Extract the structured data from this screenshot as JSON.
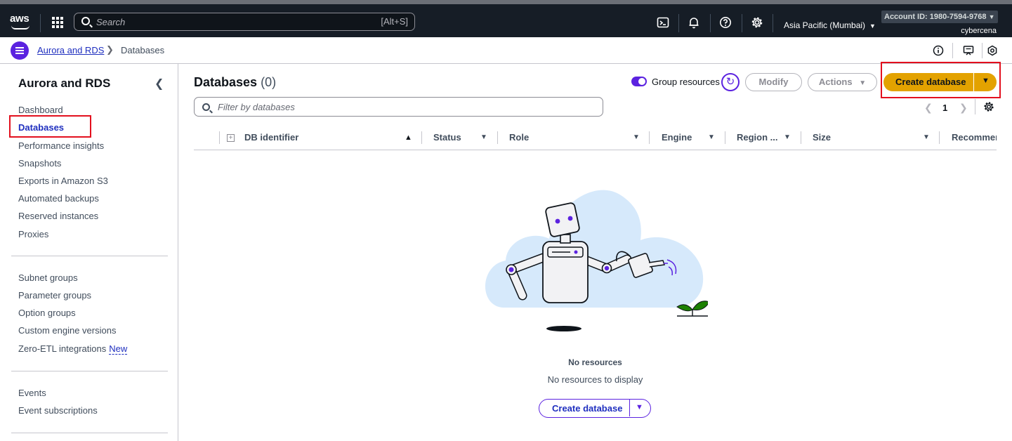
{
  "topbar": {
    "logo": "aws",
    "search_placeholder": "Search",
    "search_shortcut": "[Alt+S]",
    "icons": [
      "cloudshell-icon",
      "bell-icon",
      "help-icon",
      "gear-icon"
    ],
    "region": "Asia Pacific (Mumbai)",
    "account": "Account ID: 1980-7594-9768",
    "user": "cybercena"
  },
  "breadcrumb": {
    "parent": "Aurora and RDS",
    "current": "Databases"
  },
  "sidebar": {
    "title": "Aurora and RDS",
    "group1": [
      "Dashboard",
      "Databases",
      "Performance insights",
      "Snapshots",
      "Exports in Amazon S3",
      "Automated backups",
      "Reserved instances",
      "Proxies"
    ],
    "group2": [
      "Subnet groups",
      "Parameter groups",
      "Option groups",
      "Custom engine versions",
      "Zero-ETL integrations"
    ],
    "new_badge": "New",
    "group3": [
      "Events",
      "Event subscriptions"
    ],
    "active_item": "Databases"
  },
  "main": {
    "title": "Databases",
    "count": "(0)",
    "group_resources_label": "Group resources",
    "modify_label": "Modify",
    "actions_label": "Actions",
    "create_label": "Create database",
    "filter_placeholder": "Filter by databases",
    "page_number": "1",
    "columns": [
      "DB identifier",
      "Status",
      "Role",
      "Engine",
      "Region ...",
      "Size",
      "Recommen"
    ],
    "empty_title": "No resources",
    "empty_subtitle": "No resources to display",
    "empty_create_label": "Create database"
  },
  "colors": {
    "topbar_bg": "#161d26",
    "accent_purple": "#5b22e0",
    "primary_button": "#e3a200",
    "link_blue": "#1f2fbf",
    "highlight_red": "#e3101e"
  }
}
